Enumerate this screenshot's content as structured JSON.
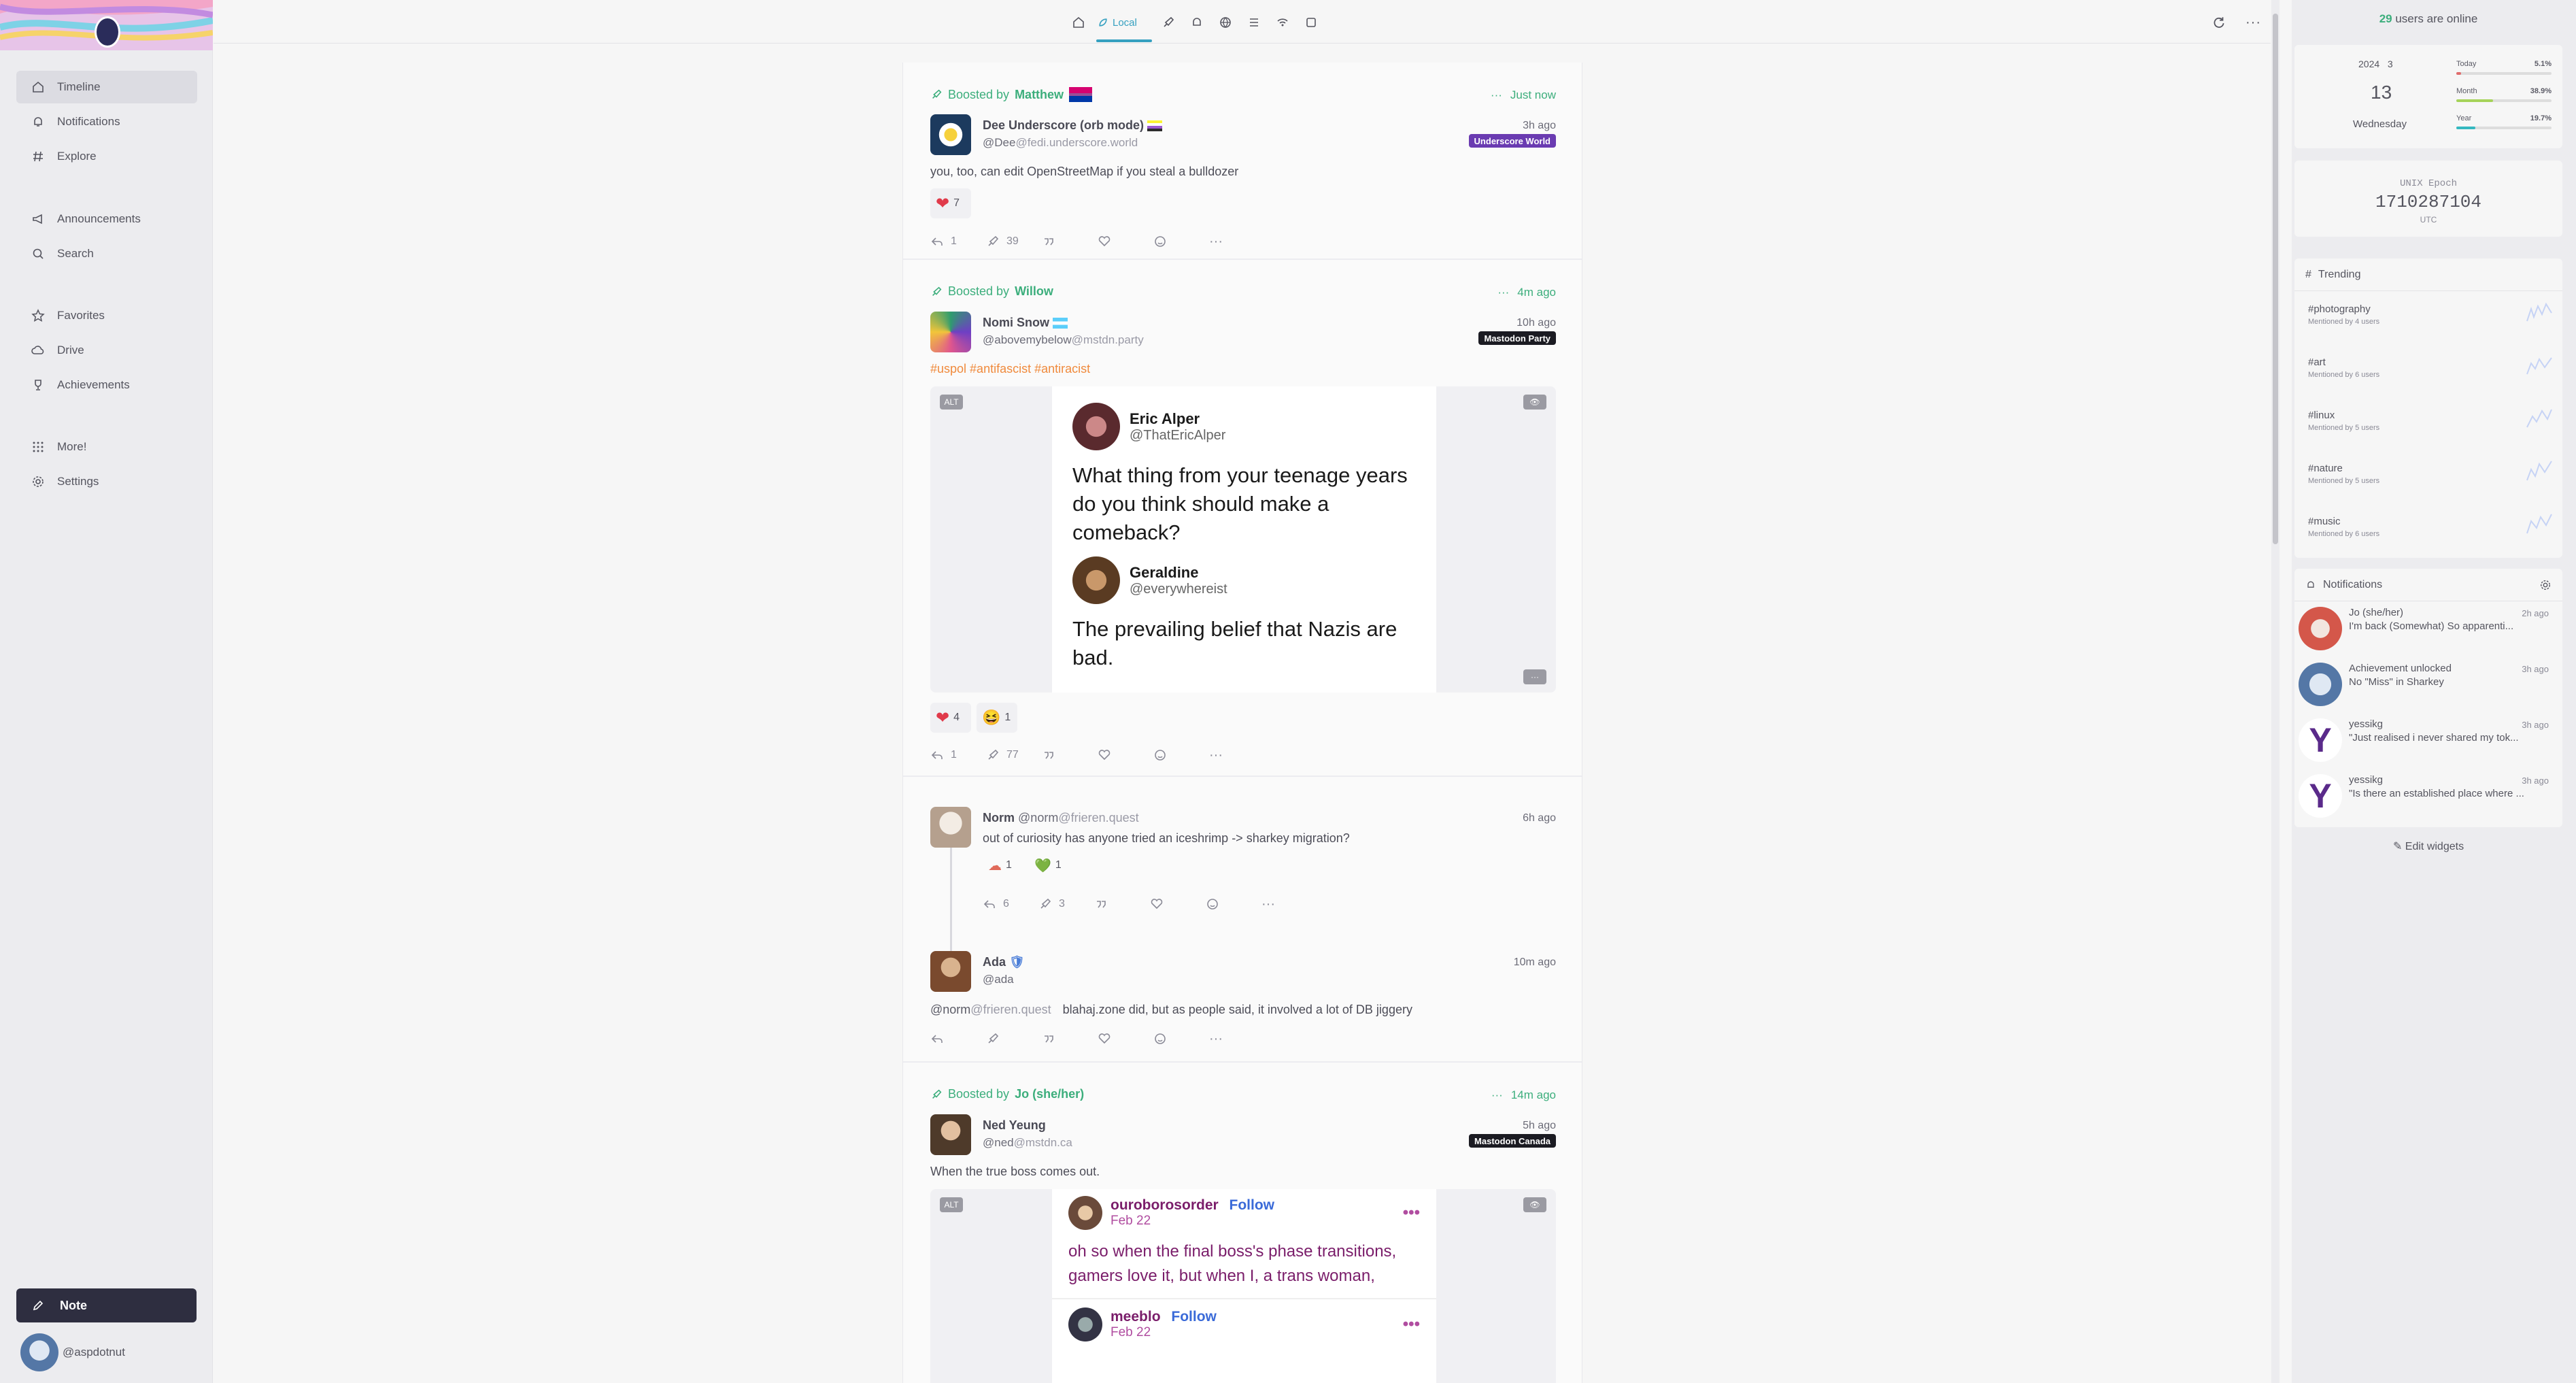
{
  "sidebar": {
    "items": [
      {
        "label": "Timeline",
        "icon": "home-icon"
      },
      {
        "label": "Notifications",
        "icon": "bell-icon"
      },
      {
        "label": "Explore",
        "icon": "hash-icon"
      },
      {
        "label": "Announcements",
        "icon": "megaphone-icon"
      },
      {
        "label": "Search",
        "icon": "search-icon"
      },
      {
        "label": "Favorites",
        "icon": "star-icon"
      },
      {
        "label": "Drive",
        "icon": "cloud-icon"
      },
      {
        "label": "Achievements",
        "icon": "trophy-icon"
      },
      {
        "label": "More!",
        "icon": "grid-icon"
      },
      {
        "label": "Settings",
        "icon": "gear-icon"
      }
    ],
    "note_button": "Note",
    "account": "@aspdotnut"
  },
  "topbar": {
    "active_tab": "Local",
    "tabs": [
      "home-icon",
      "local-icon",
      "rocket-icon",
      "bell-icon",
      "globe-icon",
      "list-icon",
      "antenna-icon",
      "channel-icon"
    ]
  },
  "notes": [
    {
      "boost_prefix": "Boosted by",
      "booster": "Matthew",
      "boost_time": "Just now",
      "name": "Dee Underscore (orb mode)",
      "handle": "@Dee",
      "host": "@fedi.underscore.world",
      "ago": "3h ago",
      "instance": "Underscore World",
      "text": "you, too, can edit OpenStreetMap if you steal a bulldozer",
      "reactions": [
        {
          "emoji": "❤",
          "count": "7"
        }
      ],
      "replies": "1",
      "renotes": "39"
    },
    {
      "boost_prefix": "Boosted by",
      "booster": "Willow",
      "boost_time": "4m ago",
      "name": "Nomi Snow",
      "handle": "@abovemybelow",
      "host": "@mstdn.party",
      "ago": "10h ago",
      "instance": "Mastodon Party",
      "hashtags": "#uspol #antifascist #antiracist",
      "media_badge": "ALT",
      "card": {
        "name1": "Eric Alper",
        "handle1": "@ThatEricAlper",
        "text1": "What thing from your teenage years do you think should make a comeback?",
        "name2": "Geraldine",
        "handle2": "@everywhereist",
        "text2": "The prevailing belief that Nazis are bad."
      },
      "reactions": [
        {
          "emoji": "❤",
          "count": "4"
        },
        {
          "emoji": "😆",
          "count": "1"
        }
      ],
      "replies": "1",
      "renotes": "77"
    },
    {
      "name": "Norm",
      "handle": "@norm",
      "host": "@frieren.quest",
      "ago": "6h ago",
      "text": "out of curiosity has anyone tried an iceshrimp -> sharkey migration?",
      "reactions": [
        {
          "emoji": "☁",
          "count": "1"
        },
        {
          "emoji": "💚",
          "count": "1"
        }
      ],
      "replies": "6",
      "renotes": "3"
    },
    {
      "name": "Ada",
      "handle": "@ada",
      "ago": "10m ago",
      "mention": "@norm",
      "mention_host": "@frieren.quest",
      "text": "blahaj.zone did, but as people said, it involved a lot of DB jiggery"
    },
    {
      "boost_prefix": "Boosted by",
      "booster": "Jo (she/her)",
      "boost_time": "14m ago",
      "name": "Ned Yeung",
      "handle": "@ned",
      "host": "@mstdn.ca",
      "ago": "5h ago",
      "instance": "Mastodon Canada",
      "text": "When the true boss comes out.",
      "media_badge": "ALT",
      "card": {
        "name1": "ouroborosorder",
        "follow": "Follow",
        "date1": "Feb 22",
        "text1": "oh so when the final boss's phase transitions, gamers love it, but when I, a trans woman,",
        "name2": "meeblo",
        "date2": "Feb 22"
      }
    }
  ],
  "widgets": {
    "online": {
      "count": "29",
      "label": "users are online"
    },
    "calendar": {
      "year": "2024",
      "month": "3",
      "day": "13",
      "weekday": "Wednesday",
      "bars": [
        {
          "label": "Today",
          "pct": "5.1%",
          "value": 0.051,
          "color": "#e06c6c"
        },
        {
          "label": "Month",
          "pct": "38.9%",
          "value": 0.389,
          "color": "#a6d35a"
        },
        {
          "label": "Year",
          "pct": "19.7%",
          "value": 0.197,
          "color": "#35b8c0"
        }
      ]
    },
    "clock": {
      "label": "UNIX Epoch",
      "value": "1710287104",
      "tz": "UTC"
    },
    "trending": {
      "title": "Trending",
      "items": [
        {
          "tag": "#photography",
          "sub": "Mentioned by 4 users"
        },
        {
          "tag": "#art",
          "sub": "Mentioned by 6 users"
        },
        {
          "tag": "#linux",
          "sub": "Mentioned by 5 users"
        },
        {
          "tag": "#nature",
          "sub": "Mentioned by 5 users"
        },
        {
          "tag": "#music",
          "sub": "Mentioned by 6 users"
        }
      ]
    },
    "notifications": {
      "title": "Notifications",
      "items": [
        {
          "title": "Jo (she/her)",
          "body": "I'm back (Somewhat)  So apparenti...",
          "ago": "2h ago"
        },
        {
          "title": "Achievement unlocked",
          "body": "No \"Miss\" in Sharkey",
          "ago": "3h ago"
        },
        {
          "title": "yessikg",
          "body": "\"Just realised i never shared my tok...",
          "ago": "3h ago"
        },
        {
          "title": "yessikg",
          "body": "\"Is there an established place where ...",
          "ago": "3h ago"
        }
      ]
    },
    "edit_label": "Edit widgets"
  }
}
